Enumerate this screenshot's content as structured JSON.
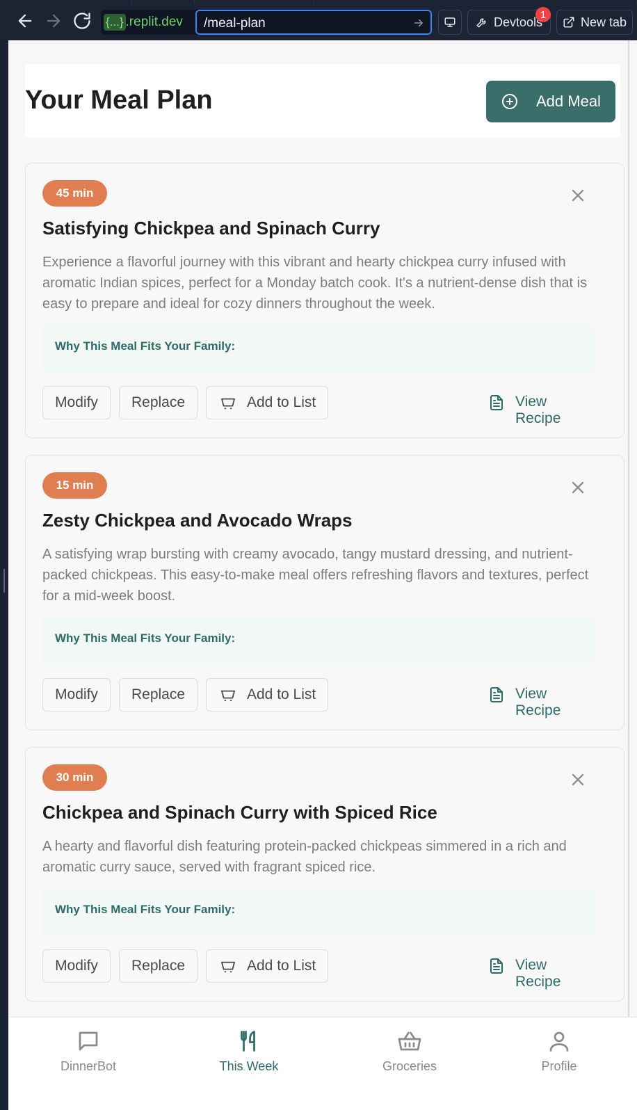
{
  "browser": {
    "url_domain_badge": "{...}",
    "url_domain_text": ".replit.dev",
    "url_path": "/meal-plan",
    "devtools_label": "Devtools",
    "devtools_badge": "1",
    "new_tab_label": "New tab"
  },
  "page": {
    "title": "Your Meal Plan",
    "add_meal_label": "Add Meal"
  },
  "meals": [
    {
      "time": "45 min",
      "title": "Satisfying Chickpea and Spinach Curry",
      "description": "Experience a flavorful journey with this vibrant and hearty chickpea curry infused with aromatic Indian spices, perfect for a Monday batch cook. It's a nutrient-dense dish that is easy to prepare and ideal for cozy dinners throughout the week.",
      "why_label": "Why This Meal Fits Your Family:",
      "modify": "Modify",
      "replace": "Replace",
      "add_to_list": "Add to List",
      "view_recipe": "View Recipe"
    },
    {
      "time": "15 min",
      "title": "Zesty Chickpea and Avocado Wraps",
      "description": "A satisfying wrap bursting with creamy avocado, tangy mustard dressing, and nutrient-packed chickpeas. This easy-to-make meal offers refreshing flavors and textures, perfect for a mid-week boost.",
      "why_label": "Why This Meal Fits Your Family:",
      "modify": "Modify",
      "replace": "Replace",
      "add_to_list": "Add to List",
      "view_recipe": "View Recipe"
    },
    {
      "time": "30 min",
      "title": "Chickpea and Spinach Curry with Spiced Rice",
      "description": "A hearty and flavorful dish featuring protein-packed chickpeas simmered in a rich and aromatic curry sauce, served with fragrant spiced rice.",
      "why_label": "Why This Meal Fits Your Family:",
      "modify": "Modify",
      "replace": "Replace",
      "add_to_list": "Add to List",
      "view_recipe": "View Recipe"
    }
  ],
  "bottom_nav": {
    "items": [
      {
        "label": "DinnerBot",
        "icon": "chat-bubble-icon",
        "active": false
      },
      {
        "label": "This Week",
        "icon": "fork-knife-icon",
        "active": true
      },
      {
        "label": "Groceries",
        "icon": "basket-icon",
        "active": false
      },
      {
        "label": "Profile",
        "icon": "user-icon",
        "active": false
      }
    ]
  },
  "colors": {
    "primary": "#3a6e6b",
    "accent_text": "#2f6b67",
    "time_badge": "#e07e52",
    "why_box_bg": "#f1f8f6"
  }
}
